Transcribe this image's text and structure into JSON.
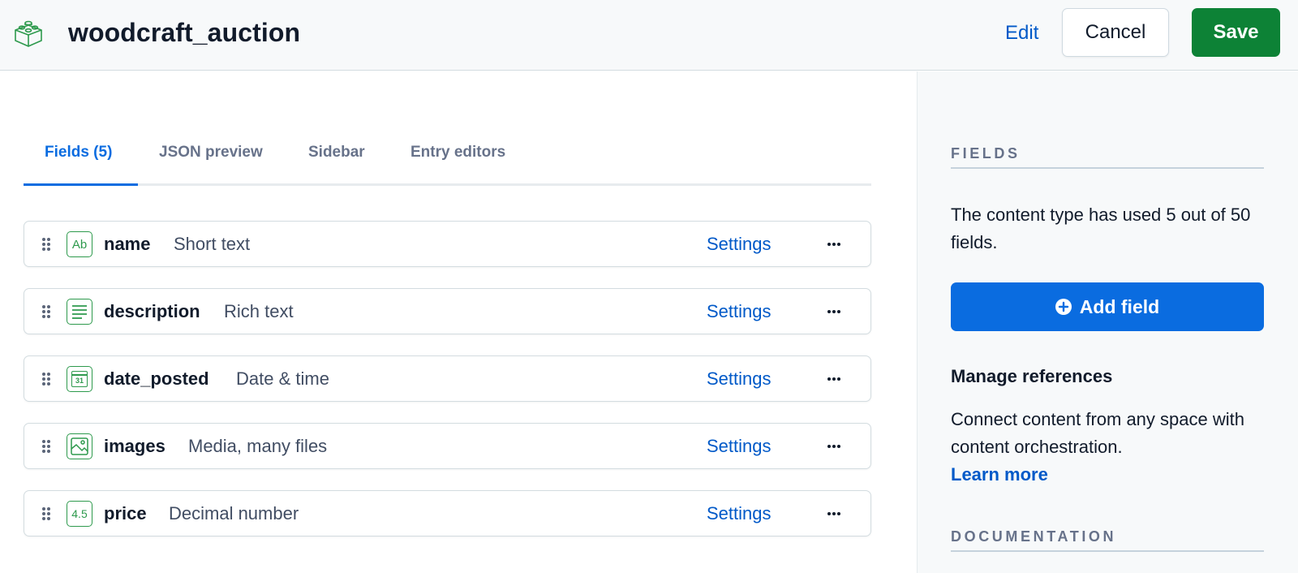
{
  "header": {
    "title": "woodcraft_auction",
    "logo_icon": "content-type-block-icon",
    "edit_label": "Edit",
    "cancel_label": "Cancel",
    "save_label": "Save"
  },
  "tabs": [
    {
      "label": "Fields (5)",
      "active": true
    },
    {
      "label": "JSON preview",
      "active": false
    },
    {
      "label": "Sidebar",
      "active": false
    },
    {
      "label": "Entry editors",
      "active": false
    }
  ],
  "fields": [
    {
      "name": "name",
      "type": "Short text",
      "icon": "short-text-icon",
      "settings_label": "Settings"
    },
    {
      "name": "description",
      "type": "Rich text",
      "icon": "rich-text-icon",
      "settings_label": "Settings"
    },
    {
      "name": "date_posted",
      "type": "Date & time",
      "icon": "calendar-icon",
      "settings_label": "Settings"
    },
    {
      "name": "images",
      "type": "Media, many files",
      "icon": "media-icon",
      "settings_label": "Settings"
    },
    {
      "name": "price",
      "type": "Decimal number",
      "icon": "decimal-number-icon",
      "settings_label": "Settings"
    }
  ],
  "field_icon_text": {
    "short_text": "Ab",
    "calendar": "31",
    "decimal": "4.5"
  },
  "sidebar": {
    "fields_heading": "FIELDS",
    "fields_usage": "The content type has used 5 out of 50 fields.",
    "fields_used": 5,
    "fields_max": 50,
    "add_field_label": "Add field",
    "manage_references_heading": "Manage references",
    "manage_references_text": "Connect content from any space with content orchestration.",
    "learn_more_label": "Learn more",
    "documentation_heading": "DOCUMENTATION"
  },
  "colors": {
    "primary": "#0a6ce0",
    "link": "#0059c8",
    "save": "#0d8236",
    "field_icon": "#2e9a4d"
  }
}
